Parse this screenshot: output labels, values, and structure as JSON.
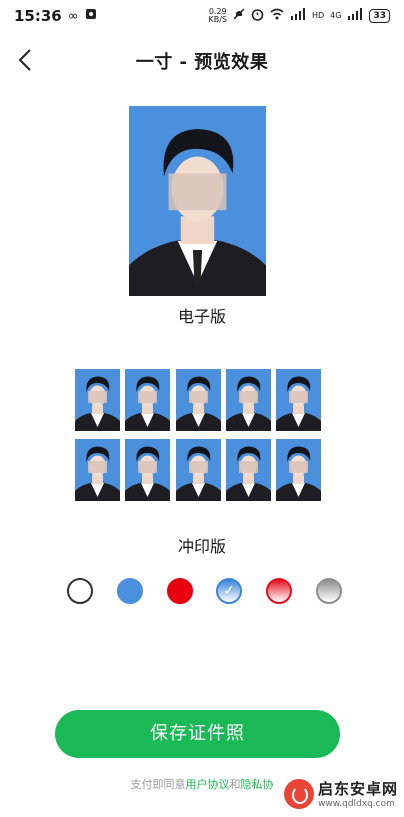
{
  "status_bar": {
    "time": "15:36",
    "speed_value": "0.29",
    "speed_unit": "KB/S",
    "network_label": "4G",
    "hd_label": "HD",
    "battery": "33"
  },
  "nav": {
    "title": "一寸 - 预览效果"
  },
  "electronic": {
    "label": "电子版",
    "background_color": "#4a90dc"
  },
  "print": {
    "label": "冲印版",
    "rows": 2,
    "columns": 5
  },
  "colors": {
    "selected_index": 3,
    "options": [
      {
        "name": "white",
        "fill": "#ffffff",
        "border": "#333333"
      },
      {
        "name": "blue",
        "fill": "#4a90dc",
        "border": "#4a90dc"
      },
      {
        "name": "red",
        "fill": "#e8000f",
        "border": "#e8000f"
      },
      {
        "name": "blue-gradient",
        "fill": "linear-gradient(180deg,#3a86d8,#ffffff)",
        "border": "#3a86d8"
      },
      {
        "name": "red-gradient",
        "fill": "linear-gradient(180deg,#e4101e,#ffffff)",
        "border": "#e4101e"
      },
      {
        "name": "gray-gradient",
        "fill": "linear-gradient(180deg,#8e8e8e,#ffffff)",
        "border": "#8e8e8e"
      }
    ]
  },
  "save_button": {
    "label": "保存证件照",
    "color": "#19b955"
  },
  "agreement": {
    "prefix": "支付即同意",
    "user_agreement": "用户协议",
    "and": "和",
    "privacy": "隐私协"
  },
  "watermark": {
    "name": "启东安卓网",
    "url": "www.qdldxq.com"
  }
}
